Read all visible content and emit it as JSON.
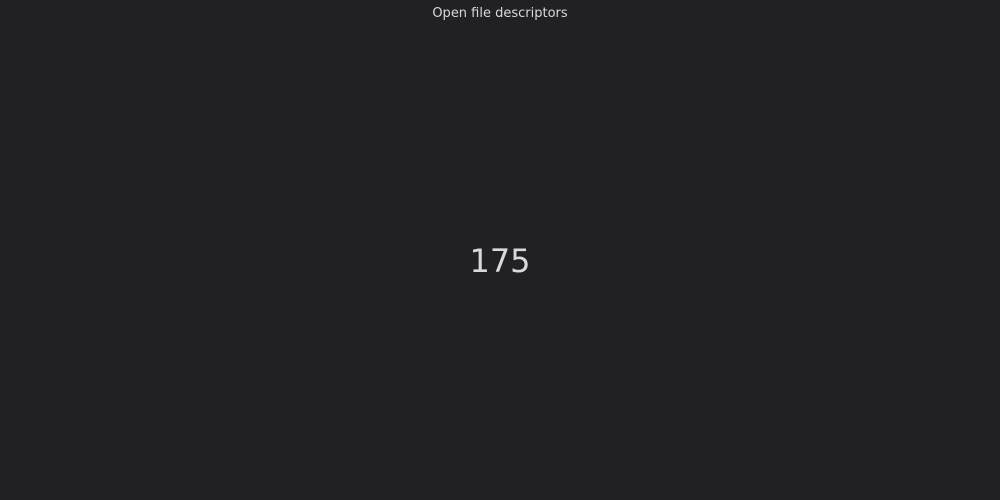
{
  "panel": {
    "title": "Open file descriptors",
    "value": "175"
  },
  "colors": {
    "background": "#212124",
    "text": "#d8d9da"
  }
}
